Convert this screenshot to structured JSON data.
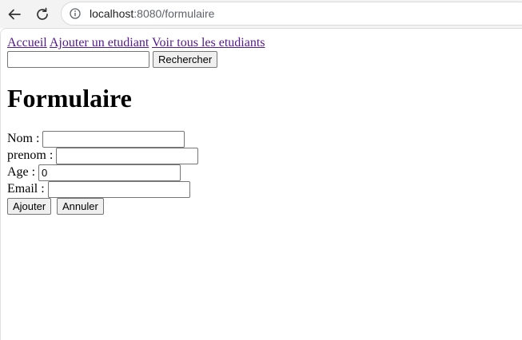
{
  "browser": {
    "url_host": "localhost",
    "url_rest": ":8080/formulaire"
  },
  "nav": {
    "links": [
      "Accueil",
      "Ajouter un etudiant",
      "Voir tous les etudiants"
    ]
  },
  "search": {
    "value": "",
    "button_label": "Rechercher"
  },
  "page_title": "Formulaire",
  "form": {
    "fields": [
      {
        "label": "Nom :",
        "value": ""
      },
      {
        "label": "prenom :",
        "value": ""
      },
      {
        "label": "Age :",
        "value": "0"
      },
      {
        "label": "Email :",
        "value": ""
      }
    ],
    "submit_label": "Ajouter",
    "cancel_label": "Annuler"
  },
  "colors": {
    "visited_link": "#551a8b",
    "button_bg": "#efefef",
    "chrome_bg": "#f3f3f3"
  },
  "icons": [
    "back-arrow-icon",
    "reload-icon",
    "info-icon"
  ]
}
